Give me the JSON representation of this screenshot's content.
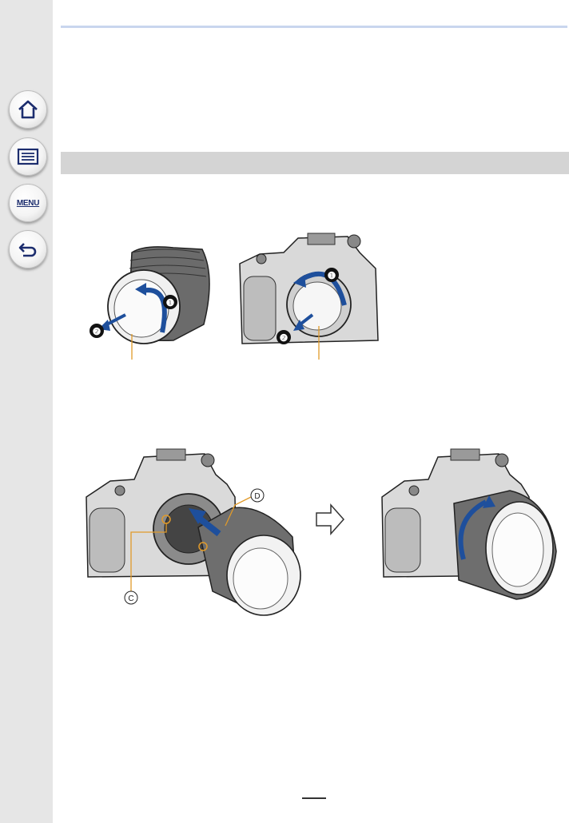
{
  "sidebar": {
    "items": [
      {
        "name": "home",
        "icon": "home-icon"
      },
      {
        "name": "contents",
        "icon": "list-icon"
      },
      {
        "name": "menu",
        "label": "MENU"
      },
      {
        "name": "back",
        "icon": "back-arrow-icon"
      }
    ]
  },
  "figures": {
    "remove_caps": {
      "step_1": "❶",
      "step_2": "❷"
    },
    "attach_lens": {
      "mark_c": "C",
      "mark_d": "D"
    }
  },
  "colors": {
    "arrow": "#1e4f9c",
    "leader": "#e09a2a",
    "sidebar": "#e6e6e6",
    "section_bar": "#d4d4d4"
  }
}
